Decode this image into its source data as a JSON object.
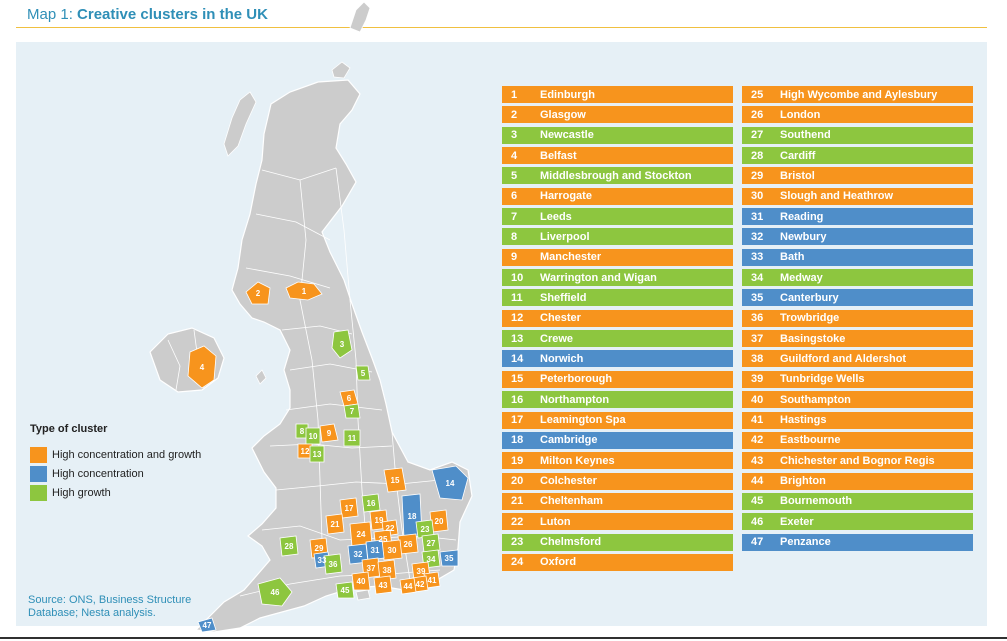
{
  "title": {
    "prefix": "Map 1: ",
    "main": "Creative clusters in the UK"
  },
  "colors": {
    "High concentration and growth": "#f7941d",
    "High concentration": "#4f8ec9",
    "High growth": "#8dc63f",
    "land": "#cccccc",
    "sea": "#e6f0f6"
  },
  "legend": {
    "title": "Type of cluster",
    "items": [
      {
        "label": "High concentration and growth",
        "color": "#f7941d"
      },
      {
        "label": "High concentration",
        "color": "#4f8ec9"
      },
      {
        "label": "High growth",
        "color": "#8dc63f"
      }
    ]
  },
  "source": "Source: ONS, Business Structure Database; Nesta analysis.",
  "clusters": [
    {
      "num": "1",
      "name": "Edinburgh",
      "type": "High concentration and growth"
    },
    {
      "num": "2",
      "name": "Glasgow",
      "type": "High concentration and growth"
    },
    {
      "num": "3",
      "name": "Newcastle",
      "type": "High growth"
    },
    {
      "num": "4",
      "name": "Belfast",
      "type": "High concentration and growth"
    },
    {
      "num": "5",
      "name": "Middlesbrough and Stockton",
      "type": "High growth"
    },
    {
      "num": "6",
      "name": "Harrogate",
      "type": "High concentration and growth"
    },
    {
      "num": "7",
      "name": "Leeds",
      "type": "High growth"
    },
    {
      "num": "8",
      "name": "Liverpool",
      "type": "High growth"
    },
    {
      "num": "9",
      "name": "Manchester",
      "type": "High concentration and growth"
    },
    {
      "num": "10",
      "name": "Warrington and Wigan",
      "type": "High growth"
    },
    {
      "num": "11",
      "name": "Sheffield",
      "type": "High growth"
    },
    {
      "num": "12",
      "name": "Chester",
      "type": "High concentration and growth"
    },
    {
      "num": "13",
      "name": "Crewe",
      "type": "High growth"
    },
    {
      "num": "14",
      "name": "Norwich",
      "type": "High concentration"
    },
    {
      "num": "15",
      "name": "Peterborough",
      "type": "High concentration and growth"
    },
    {
      "num": "16",
      "name": "Northampton",
      "type": "High growth"
    },
    {
      "num": "17",
      "name": "Leamington Spa",
      "type": "High concentration and growth"
    },
    {
      "num": "18",
      "name": "Cambridge",
      "type": "High concentration"
    },
    {
      "num": "19",
      "name": "Milton Keynes",
      "type": "High concentration and growth"
    },
    {
      "num": "20",
      "name": "Colchester",
      "type": "High concentration and growth"
    },
    {
      "num": "21",
      "name": "Cheltenham",
      "type": "High concentration and growth"
    },
    {
      "num": "22",
      "name": "Luton",
      "type": "High concentration and growth"
    },
    {
      "num": "23",
      "name": "Chelmsford",
      "type": "High growth"
    },
    {
      "num": "24",
      "name": "Oxford",
      "type": "High concentration and growth"
    },
    {
      "num": "25",
      "name": "High Wycombe and Aylesbury",
      "type": "High concentration and growth"
    },
    {
      "num": "26",
      "name": "London",
      "type": "High concentration and growth"
    },
    {
      "num": "27",
      "name": "Southend",
      "type": "High growth"
    },
    {
      "num": "28",
      "name": "Cardiff",
      "type": "High growth"
    },
    {
      "num": "29",
      "name": "Bristol",
      "type": "High concentration and growth"
    },
    {
      "num": "30",
      "name": "Slough and Heathrow",
      "type": "High concentration and growth"
    },
    {
      "num": "31",
      "name": "Reading",
      "type": "High concentration"
    },
    {
      "num": "32",
      "name": "Newbury",
      "type": "High concentration"
    },
    {
      "num": "33",
      "name": "Bath",
      "type": "High concentration"
    },
    {
      "num": "34",
      "name": "Medway",
      "type": "High growth"
    },
    {
      "num": "35",
      "name": "Canterbury",
      "type": "High concentration"
    },
    {
      "num": "36",
      "name": "Trowbridge",
      "type": "High concentration and growth"
    },
    {
      "num": "37",
      "name": "Basingstoke",
      "type": "High concentration and growth"
    },
    {
      "num": "38",
      "name": "Guildford and Aldershot",
      "type": "High concentration and growth"
    },
    {
      "num": "39",
      "name": "Tunbridge Wells",
      "type": "High concentration and growth"
    },
    {
      "num": "40",
      "name": "Southampton",
      "type": "High concentration and growth"
    },
    {
      "num": "41",
      "name": "Hastings",
      "type": "High concentration and growth"
    },
    {
      "num": "42",
      "name": "Eastbourne",
      "type": "High concentration and growth"
    },
    {
      "num": "43",
      "name": "Chichester and Bognor Regis",
      "type": "High concentration and growth"
    },
    {
      "num": "44",
      "name": "Brighton",
      "type": "High concentration and growth"
    },
    {
      "num": "45",
      "name": "Bournemouth",
      "type": "High growth"
    },
    {
      "num": "46",
      "name": "Exeter",
      "type": "High growth"
    },
    {
      "num": "47",
      "name": "Penzance",
      "type": "High concentration"
    }
  ]
}
